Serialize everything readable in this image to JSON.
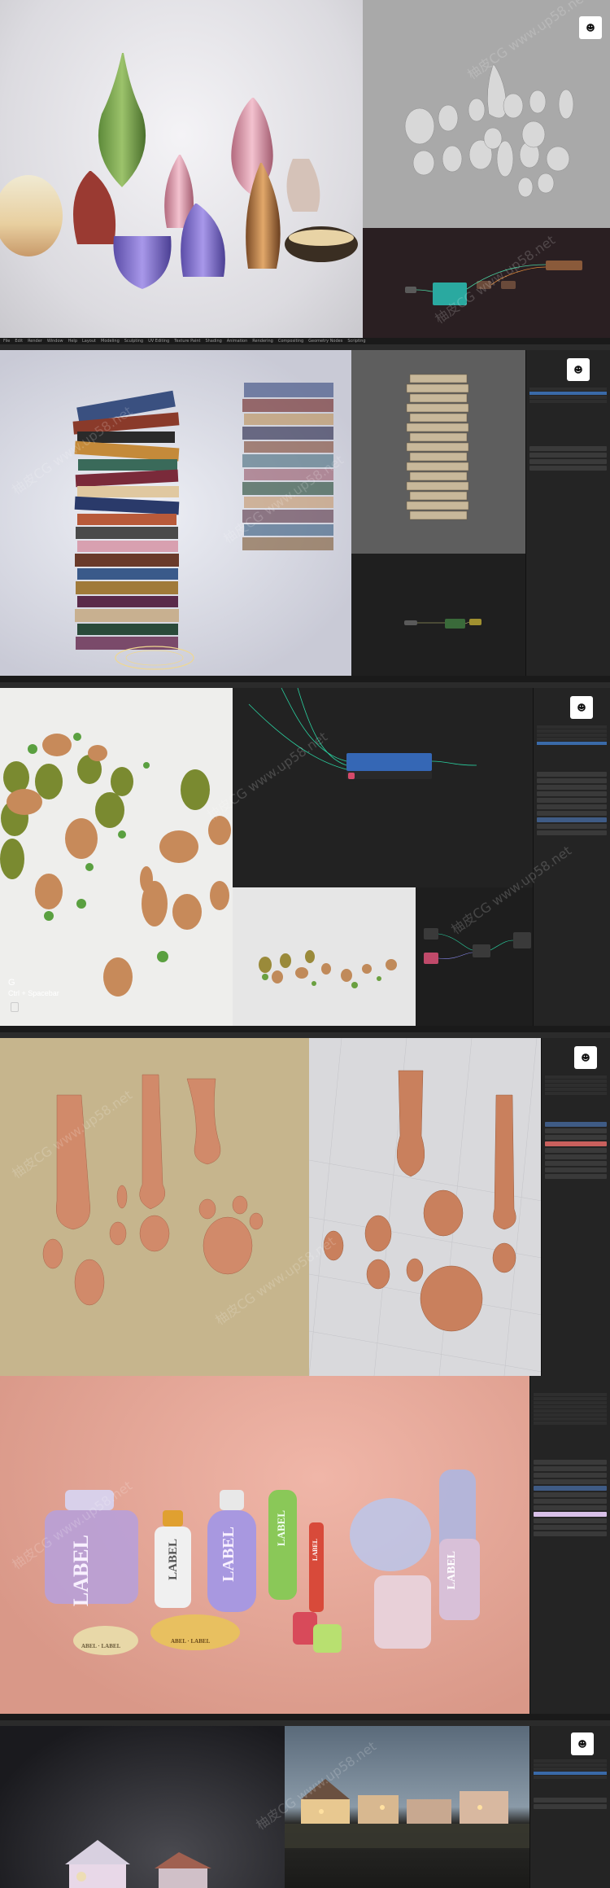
{
  "menu": [
    "File",
    "Edit",
    "Render",
    "Window",
    "Help",
    "Layout",
    "Modeling",
    "Sculpting",
    "UV Editing",
    "Texture Paint",
    "Shading",
    "Animation",
    "Rendering",
    "Compositing",
    "Geometry Nodes",
    "Scripting"
  ],
  "watermark": {
    "text_url": "www.up58.net",
    "text_brand": "柚皮CG",
    "text_full": "柚皮CG www.up58.net"
  },
  "viewport_hint": {
    "key": "G",
    "shortcut": "Ctrl + Spacebar"
  },
  "panel5_labels": {
    "big_bottle": "LABEL",
    "tall_bottle": "LABEL",
    "small_bottle": "LABEL",
    "green_bottle": "LABEL",
    "red_bottle": "LABEL",
    "jar_left": "ABEL · LABEL",
    "jar_right": "ABEL · LABEL",
    "pink_bottle": "LABEL"
  },
  "colors": {
    "blender_bg": "#232323",
    "selection_blue": "#3a6aa8",
    "node_teal": "#2aa9a0",
    "node_blue": "#3567b5",
    "panel4_bg": "#c6b58d",
    "panel5_bg": "#dba59a"
  }
}
